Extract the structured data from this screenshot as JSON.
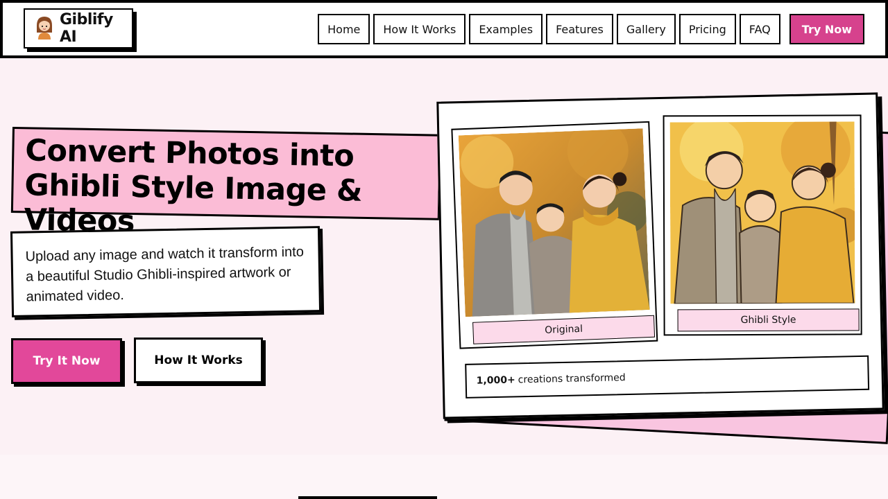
{
  "brand": {
    "name": "Giblify AI",
    "logo_icon": "girl-avatar-icon"
  },
  "nav": {
    "items": [
      "Home",
      "How It Works",
      "Examples",
      "Features",
      "Gallery",
      "Pricing",
      "FAQ"
    ],
    "cta": "Try Now"
  },
  "hero": {
    "title": "Convert Photos into Ghibli Style Image & Videos",
    "description": "Upload any image and watch it transform into a beautiful Studio Ghibli-inspired artwork or animated video.",
    "primary_button": "Try It Now",
    "secondary_button": "How It Works"
  },
  "showcase": {
    "original_label": "Original",
    "ghibli_label": "Ghibli Style",
    "stat_count": "1,000+",
    "stat_text": "creations transformed"
  },
  "colors": {
    "accent": "#e2489a",
    "accent_dark": "#d6428d",
    "title_bg": "#fbbcd6",
    "page_bg": "#fcf1f5"
  }
}
